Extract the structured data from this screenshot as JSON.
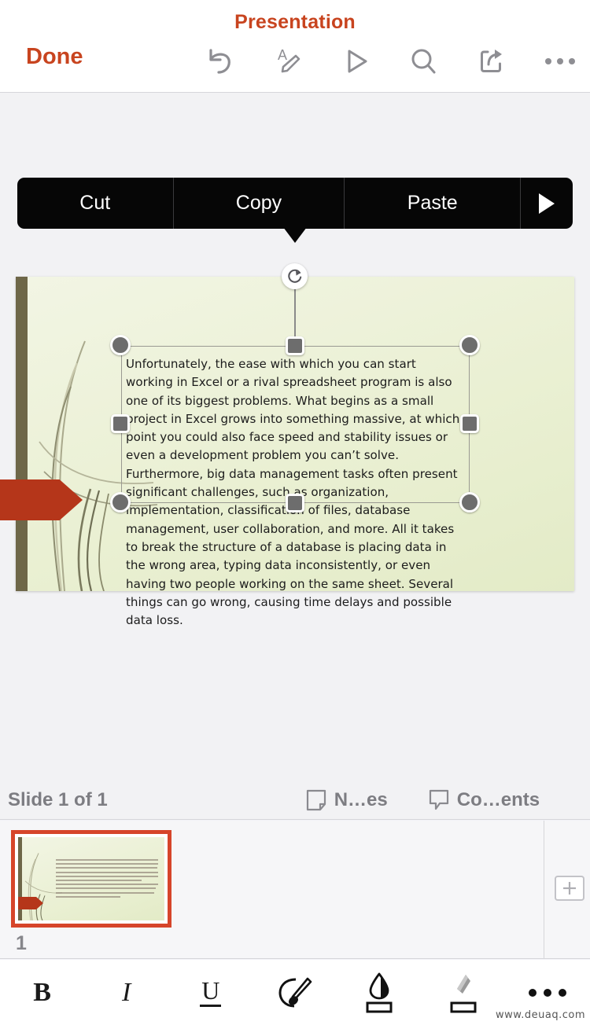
{
  "app": {
    "title": "Presentation",
    "done_label": "Done",
    "accent_color": "#c8441f",
    "watermark": "www.deuaq.com"
  },
  "toolbar_top": {
    "icons": [
      {
        "name": "undo-icon",
        "label": "Undo"
      },
      {
        "name": "text-edit-icon",
        "label": "Edit Text"
      },
      {
        "name": "play-icon",
        "label": "Play Slideshow"
      },
      {
        "name": "search-icon",
        "label": "Search"
      },
      {
        "name": "share-icon",
        "label": "Share"
      },
      {
        "name": "more-icon",
        "label": "More"
      }
    ]
  },
  "context_menu": {
    "items": [
      {
        "name": "cut-menu-item",
        "label": "Cut"
      },
      {
        "name": "copy-menu-item",
        "label": "Copy"
      },
      {
        "name": "paste-menu-item",
        "label": "Paste"
      }
    ],
    "next_label": "",
    "background_color": "#060606"
  },
  "slide": {
    "background_color": "#eaf0d3",
    "left_bar_color": "#6e6748",
    "arrow_color": "#b5361a",
    "textbox": {
      "text": "Unfortunately, the ease with which you can start working in Excel or a rival spreadsheet program is also one of its biggest problems. What begins as a small project in Excel grows into something massive, at which point you could also face speed and stability issues or even a development problem you can’t solve. Furthermore, big data management tasks often present significant challenges, such as organization, implementation, classification of files, database management, user collaboration, and more. All it takes to break the structure of a database is placing data in the wrong area, typing data inconsistently, or even having two people working on the same sheet. Several things can go wrong, causing time delays and possible data loss.",
      "selected": true
    }
  },
  "status_bar": {
    "slide_count_label": "Slide 1 of 1",
    "notes_label": "N…es",
    "comments_label": "Co…ents"
  },
  "thumbnails": {
    "items": [
      {
        "number": "1",
        "selected": true
      }
    ],
    "add_label": "+",
    "selection_color": "#d6452a"
  },
  "toolbar_bottom": {
    "items": [
      {
        "name": "bold-button",
        "label": "B"
      },
      {
        "name": "italic-button",
        "label": "I"
      },
      {
        "name": "underline-button",
        "label": "U"
      },
      {
        "name": "format-painter-button",
        "label": ""
      },
      {
        "name": "fill-color-button",
        "label": ""
      },
      {
        "name": "highlight-color-button",
        "label": ""
      },
      {
        "name": "more-format-button",
        "label": ""
      }
    ]
  }
}
